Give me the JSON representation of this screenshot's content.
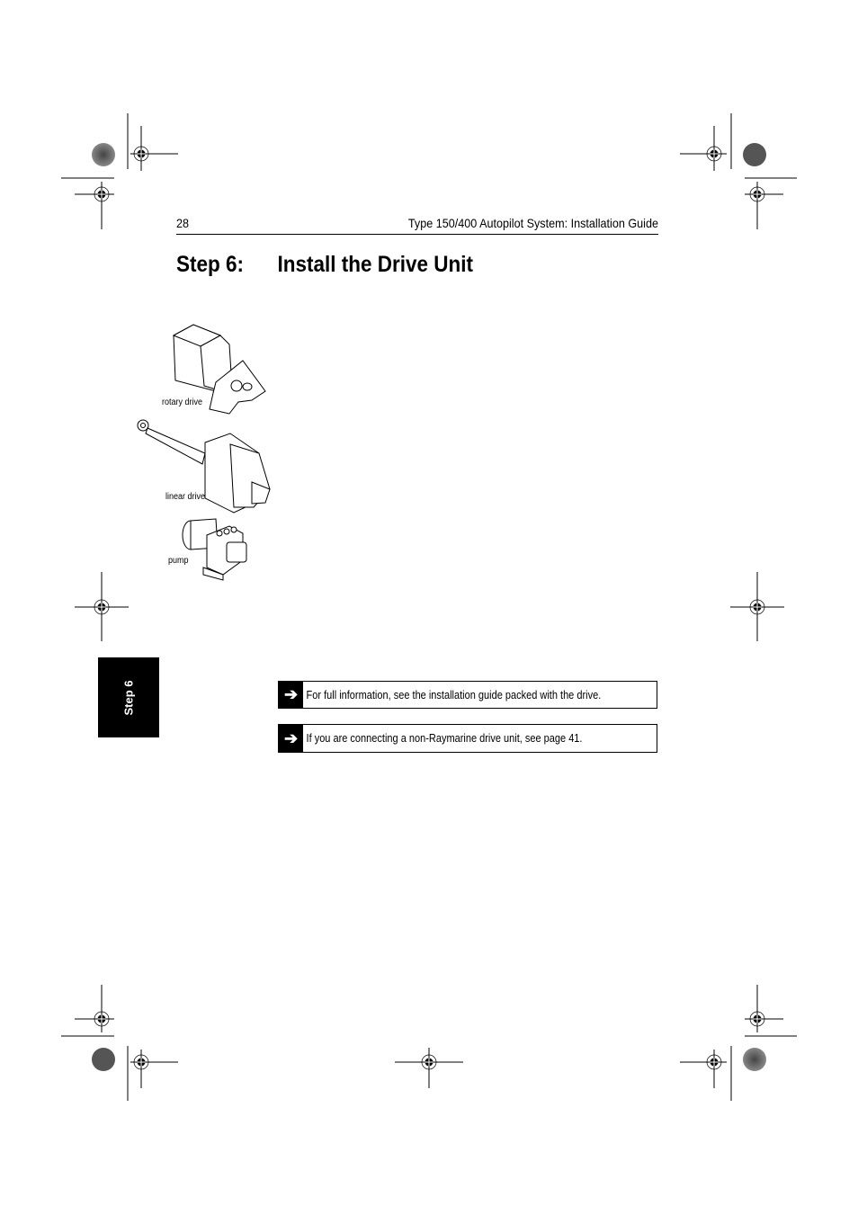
{
  "header": {
    "page_number": "28",
    "running_title": "Type 150/400 Autopilot System: Installation Guide"
  },
  "title": {
    "step": "Step 6:",
    "text": "Install the Drive Unit"
  },
  "figures": [
    {
      "caption": "rotary drive",
      "icon": "rotary-drive-illustration"
    },
    {
      "caption": "linear drive",
      "icon": "linear-drive-illustration"
    },
    {
      "caption": "pump",
      "icon": "pump-illustration"
    }
  ],
  "side_tab": {
    "label": "Step 6"
  },
  "notes": [
    {
      "icon": "arrow-right-icon",
      "glyph": "➔",
      "text": "For full information, see the installation guide packed with the drive."
    },
    {
      "icon": "arrow-right-icon",
      "glyph": "➔",
      "text": "If you are connecting a non-Raymarine drive unit, see page 41."
    }
  ]
}
